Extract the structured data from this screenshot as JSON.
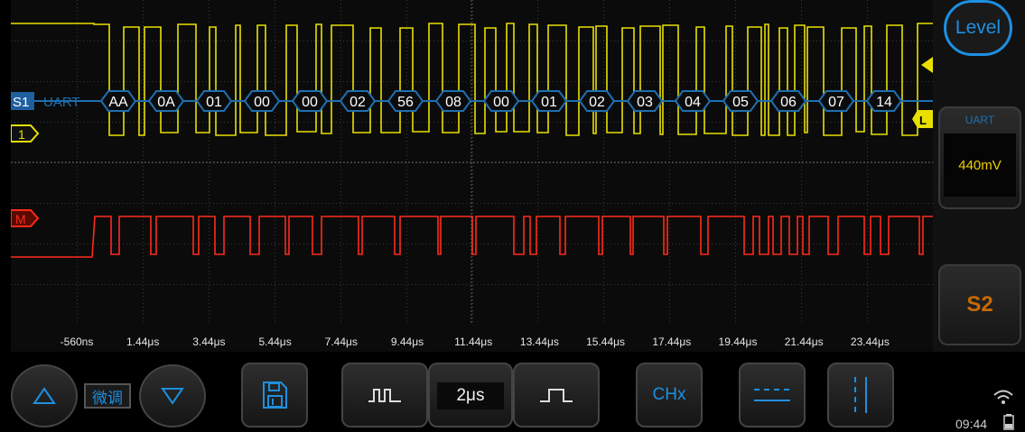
{
  "trigger": {
    "level_label": "Level"
  },
  "serial_bus": {
    "label": "S1",
    "protocol": "UART",
    "frames": [
      "AA",
      "0A",
      "01",
      "00",
      "00",
      "02",
      "56",
      "08",
      "00",
      "01",
      "02",
      "03",
      "04",
      "05",
      "06",
      "07",
      "14"
    ]
  },
  "channels": {
    "ch1": {
      "label": "1",
      "color": "#e8e000"
    },
    "math": {
      "label": "M",
      "color": "#ff2a1a"
    }
  },
  "trigger_marker": {
    "label": "L"
  },
  "time_axis": [
    "-560ns",
    "1.44μs",
    "3.44μs",
    "5.44μs",
    "7.44μs",
    "9.44μs",
    "11.44μs",
    "13.44μs",
    "15.44μs",
    "17.44μs",
    "19.44μs",
    "21.44μs",
    "23.44μs"
  ],
  "side_panel": {
    "uart_header": "UART",
    "uart_level": "440mV",
    "s2_label": "S2"
  },
  "toolbar": {
    "fine_label": "微调",
    "timebase": "2μs",
    "chx_label": "CHx"
  },
  "status": {
    "clock": "09:44"
  },
  "colors": {
    "accent": "#1e8fe0",
    "bus": "#1e6fb0",
    "grid": "#3a3a3a"
  }
}
